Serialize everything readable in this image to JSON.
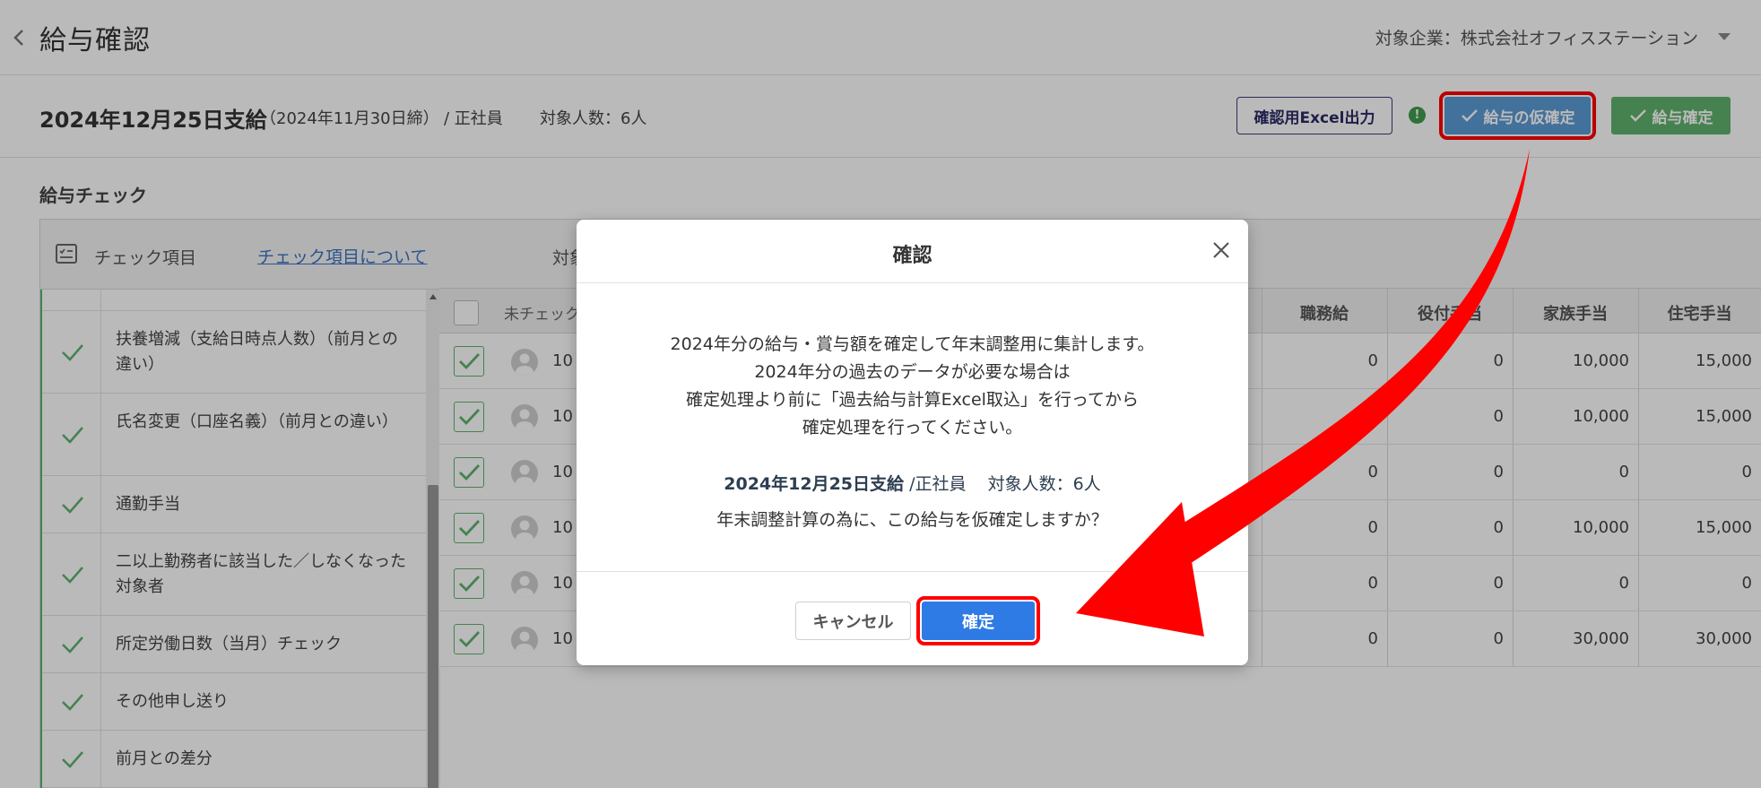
{
  "header": {
    "title": "給与確認",
    "company": "対象企業：株式会社オフィスステーション"
  },
  "subbar": {
    "pay_date": "2024年12月25日支給",
    "close_date": "（2024年11月30日締）",
    "employment_type": "/ 正社員",
    "headcount": "対象人数：6人",
    "excel_button": "確認用Excel出力",
    "info_mark": "!",
    "provisional_button": "給与の仮確定",
    "confirm_button": "給与確定"
  },
  "check_section": {
    "label": "給与チェック",
    "head_title": "チェック項目",
    "head_link": "チェック項目について",
    "items": [
      {
        "label": "扶養増減（支給日時点人数）（前月との違い）"
      },
      {
        "label": "氏名変更（口座名義）（前月との違い）"
      },
      {
        "label": "通勤手当"
      },
      {
        "label": "二以上勤務者に該当した／しなくなった対象者"
      },
      {
        "label": "所定労働日数（当月）チェック"
      },
      {
        "label": "その他申し送り"
      },
      {
        "label": "前月との差分"
      }
    ]
  },
  "table": {
    "target_label": "対象",
    "unchecked_label": "未チェック",
    "columns": [
      "職務給",
      "役付手当",
      "家族手当",
      "住宅手当"
    ],
    "rows": [
      {
        "code": "10",
        "values": [
          "0",
          "0",
          "10,000",
          "15,000"
        ]
      },
      {
        "code": "10",
        "values": [
          "0",
          "0",
          "10,000",
          "15,000"
        ]
      },
      {
        "code": "10",
        "values": [
          "0",
          "0",
          "0",
          "0"
        ]
      },
      {
        "code": "10",
        "values": [
          "0",
          "0",
          "10,000",
          "15,000"
        ]
      },
      {
        "code": "10",
        "values": [
          "0",
          "0",
          "0",
          "0"
        ]
      },
      {
        "code": "10",
        "values": [
          "0",
          "0",
          "30,000",
          "30,000"
        ]
      }
    ]
  },
  "modal": {
    "title": "確認",
    "message_lines": [
      "2024年分の給与・賞与額を確定して年末調整用に集計します。",
      "2024年分の過去のデータが必要な場合は",
      "確定処理より前に「過去給与計算Excel取込」を行ってから",
      "確定処理を行ってください。"
    ],
    "summary_date": "2024年12月25日支給",
    "summary_type": "/正社員",
    "summary_count": "対象人数：6人",
    "question": "年末調整計算の為に、この給与を仮確定しますか？",
    "cancel_label": "キャンセル",
    "ok_label": "確定"
  },
  "colors": {
    "primary": "#2f7be5",
    "confirm_green": "#5fb26d",
    "highlight_red": "#ff0000"
  }
}
